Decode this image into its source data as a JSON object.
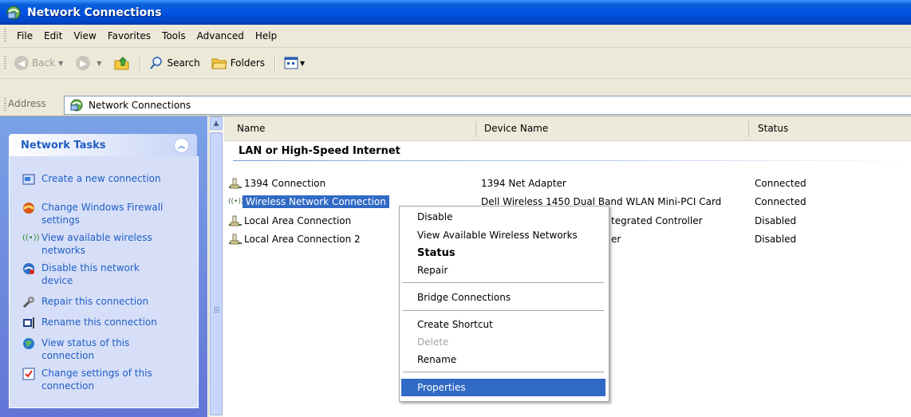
{
  "window": {
    "title": "Network Connections"
  },
  "menubar": {
    "items": [
      "File",
      "Edit",
      "View",
      "Favorites",
      "Tools",
      "Advanced",
      "Help"
    ]
  },
  "toolbar": {
    "back_label": "Back",
    "search_label": "Search",
    "folders_label": "Folders"
  },
  "address": {
    "label": "Address",
    "value": "Network Connections"
  },
  "taskpane": {
    "title": "Network Tasks",
    "tasks": [
      {
        "label": "Create a new connection",
        "icon": "new-connection-icon"
      },
      {
        "label": "Change Windows Firewall settings",
        "icon": "firewall-icon"
      },
      {
        "label": "View available wireless networks",
        "icon": "wireless-icon"
      },
      {
        "label": "Disable this network device",
        "icon": "disable-icon"
      },
      {
        "label": "Repair this connection",
        "icon": "repair-icon"
      },
      {
        "label": "Rename this connection",
        "icon": "rename-icon"
      },
      {
        "label": "View status of this connection",
        "icon": "status-icon"
      },
      {
        "label": "Change settings of this connection",
        "icon": "settings-icon"
      }
    ]
  },
  "list": {
    "columns": [
      "Name",
      "Device Name",
      "Status"
    ],
    "group": "LAN or High-Speed Internet",
    "rows": [
      {
        "name": "1394 Connection",
        "device": "1394 Net Adapter",
        "status": "Connected",
        "icon": "lan-icon"
      },
      {
        "name": "Wireless Network Connection",
        "device": "Dell Wireless 1450 Dual Band WLAN Mini-PCI Card",
        "status": "Connected",
        "icon": "wireless-icon",
        "selected": true
      },
      {
        "name": "Local Area Connection",
        "device": "tegrated Controller",
        "status": "Disabled",
        "icon": "lan-icon"
      },
      {
        "name": "Local Area Connection 2",
        "device": "er",
        "status": "Disabled",
        "icon": "lan-icon"
      }
    ]
  },
  "context_menu": {
    "items": [
      "Disable",
      "View Available Wireless Networks",
      "Status",
      "Repair",
      "Bridge Connections",
      "Create Shortcut",
      "Delete",
      "Rename",
      "Properties"
    ],
    "bold": "Status",
    "disabled": "Delete",
    "highlighted": "Properties"
  },
  "colors": {
    "title_bar": "#0054e3",
    "link": "#215dc6",
    "selection": "#316ac5",
    "task_pane": "#6375d6"
  }
}
